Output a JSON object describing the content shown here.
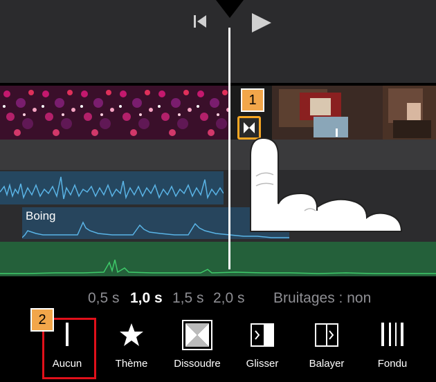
{
  "durations": {
    "d05": "0,5 s",
    "d10": "1,0 s",
    "d15": "1,5 s",
    "d20": "2,0 s",
    "selected": "1,0 s"
  },
  "sound_effects": "Bruitages : non",
  "audio_clip_label": "Boing",
  "badges": {
    "b1": "1",
    "b2": "2"
  },
  "transitions": [
    {
      "label": "Aucun",
      "icon": "line-icon",
      "selected": true
    },
    {
      "label": "Thème",
      "icon": "star-icon"
    },
    {
      "label": "Dissoudre",
      "icon": "dissolve-icon"
    },
    {
      "label": "Glisser",
      "icon": "slide-icon"
    },
    {
      "label": "Balayer",
      "icon": "wipe-icon"
    },
    {
      "label": "Fondu",
      "icon": "fade-icon"
    }
  ],
  "colors": {
    "accent_orange": "#f6a623",
    "highlight_red": "#e1101a",
    "audio_wave": "#5ab4e6",
    "music_wave": "#3ecb6a"
  }
}
